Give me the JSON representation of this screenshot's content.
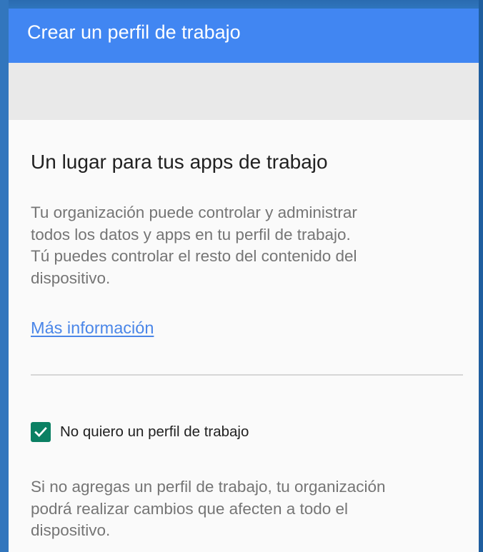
{
  "toolbar": {
    "title": "Crear un perfil de trabajo"
  },
  "content": {
    "heading": "Un lugar para tus apps de trabajo",
    "description_lines": [
      "Tu organización puede controlar y administrar",
      "todos los datos y apps en tu perfil de trabajo.",
      "Tú puedes controlar el resto del contenido del",
      "dispositivo."
    ],
    "more_info_link": "Más información"
  },
  "opt_out": {
    "checkbox_label": "No quiero un perfil de trabajo",
    "checked": true,
    "checkbox_icon": "check-icon",
    "footer_lines": [
      "Si no agregas un perfil de trabajo, tu organización",
      "podrá realizar cambios que afecten a todo el",
      "dispositivo."
    ]
  },
  "colors": {
    "toolbar": "#4186f2",
    "link": "#4a86e8",
    "checkbox": "#0b8063",
    "background": "#fafafa"
  }
}
